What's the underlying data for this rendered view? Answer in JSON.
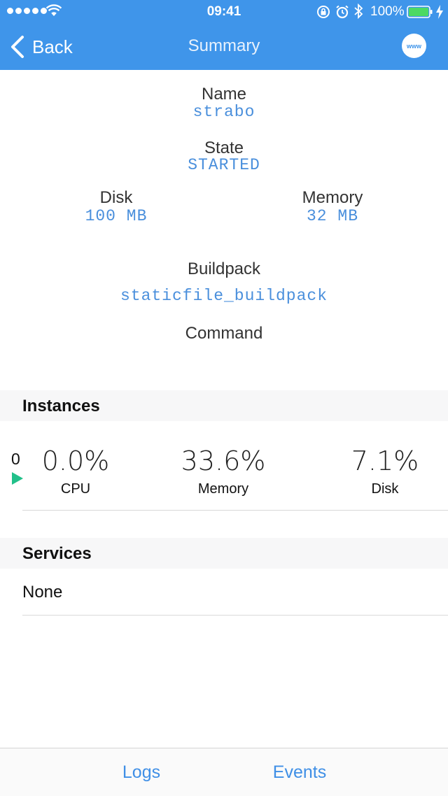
{
  "status_bar": {
    "time": "09:41",
    "battery_percent": "100%"
  },
  "nav": {
    "back_label": "Back",
    "title": "Summary",
    "www_label": "www"
  },
  "summary": {
    "name_label": "Name",
    "name_value": "strabo",
    "state_label": "State",
    "state_value": "STARTED",
    "disk_label": "Disk",
    "disk_value": "100 MB",
    "memory_label": "Memory",
    "memory_value": "32 MB",
    "buildpack_label": "Buildpack",
    "buildpack_value": "staticfile_buildpack",
    "command_label": "Command"
  },
  "instances": {
    "header": "Instances",
    "rows": [
      {
        "index": "0",
        "cpu_value": "0.0%",
        "cpu_label": "CPU",
        "memory_value": "33.6%",
        "memory_label": "Memory",
        "disk_value": "7.1%",
        "disk_label": "Disk"
      }
    ]
  },
  "services": {
    "header": "Services",
    "empty_text": "None"
  },
  "toolbar": {
    "logs_label": "Logs",
    "events_label": "Events"
  },
  "colors": {
    "nav_background": "#3f95ea",
    "value_blue": "#4a8fdc",
    "running_green": "#22c08a"
  }
}
